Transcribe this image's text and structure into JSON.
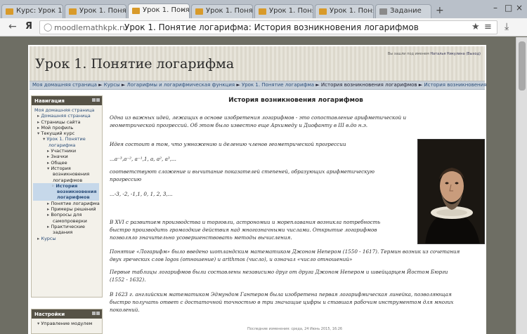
{
  "browser": {
    "tabs": [
      {
        "label": "Курс: Урок 1. Г",
        "active": false
      },
      {
        "label": "Урок 1. Понятие",
        "active": false
      },
      {
        "label": "Урок 1. Понятие",
        "active": true
      },
      {
        "label": "Урок 1. Понятие",
        "active": false
      },
      {
        "label": "Урок 1. Понятие",
        "active": false
      },
      {
        "label": "Урок 1. Понятие",
        "active": false
      },
      {
        "label": "Задание",
        "active": false
      }
    ],
    "new_tab": "+",
    "yandex": "Я",
    "url_domain": "moodlemathkpk.ru",
    "url_title": "Урок 1. Понятие логарифма: История возникновения логарифмов"
  },
  "page": {
    "header_title": "Урок 1. Понятие логарифма",
    "login_text": "Вы зашли под именем",
    "login_user": "Наталья Никулина",
    "login_exit": "(Выход)",
    "breadcrumb": {
      "home": "Моя домашняя страница",
      "courses": "Курсы",
      "category": "Логарифмы и логарифмическая функция",
      "lesson": "Урок 1. Понятие логарифма",
      "page1": "История возникновения логарифмов",
      "page2": "История возникновения логарифмов"
    }
  },
  "navigation": {
    "title": "Навигация",
    "home": "Моя домашняя страница",
    "items": [
      {
        "label": "Домашняя страница",
        "style": "link"
      },
      {
        "label": "Страницы сайта",
        "style": "plain"
      },
      {
        "label": "Мой профиль",
        "style": "plain"
      },
      {
        "label": "Текущий курс",
        "style": "plain"
      },
      {
        "label": "Урок 1. Понятие",
        "style": "link"
      },
      {
        "label": "логарифма",
        "style": "link"
      },
      {
        "label": "Участники",
        "style": "plain"
      },
      {
        "label": "Значки",
        "style": "plain"
      },
      {
        "label": "Общее",
        "style": "plain"
      },
      {
        "label": "История",
        "style": "plain"
      },
      {
        "label": "возникновения",
        "style": "plain"
      },
      {
        "label": "логарифмов",
        "style": "plain"
      },
      {
        "label": "История",
        "style": "current"
      },
      {
        "label": "возникновения",
        "style": "current"
      },
      {
        "label": "логарифмов",
        "style": "current"
      },
      {
        "label": "Понятие логарифма",
        "style": "plain"
      },
      {
        "label": "Примеры решений",
        "style": "plain"
      },
      {
        "label": "Вопросы для",
        "style": "plain"
      },
      {
        "label": "самопроверки",
        "style": "plain"
      },
      {
        "label": "Практические",
        "style": "plain"
      },
      {
        "label": "задания",
        "style": "plain"
      },
      {
        "label": "Курсы",
        "style": "link"
      }
    ]
  },
  "settings": {
    "title": "Настройки",
    "item": "Управление модулем"
  },
  "content": {
    "heading": "История возникновения логарифмов",
    "p1a": "Одна из важных идей, лежащих в основе  изобретения логарифмов - это сопоставление  арифметической и",
    "p1b": "геометрической прогрессий. Об этом было известно еще  Архимеду  и Диофанту  в III в.до н.э.",
    "p2": "Идея состоит в том, что умножению и делению членов геометрической прогрессии",
    "p3": "...a⁻³,a⁻², a⁻¹,1, a, a², a³,...",
    "p4a": "соответствуют сложение и вычитание показателей степеней, образующих арифметическую",
    "p4b": "прогрессию",
    "p5": "...-3, -2, -1,1, 0, 1, 2, 3,...",
    "p6a": "В XVI с развитием   производства и торговли, астрономии и мореплавания возникла  потребность",
    "p6b": "быстро производить громоздкие действия над многозначными числами. Открытие логарифмов",
    "p6c": "позволяло значительно усовершенствовать методы вычисления.",
    "p7a": "Понятие  «Логарифм» было введено шотландским математиком Джоном Непером (1550 - 1617). Термин возник из сочетания",
    "p7b": "двух греческих слов logos (отношение) и arithmos (число), и означал «число отношений»",
    "p8a": "Первые таблицы логарифмов были составлены независимо друг от друга Джоном Непером и швейцарцем Йостом Бюрги",
    "p8b": "(1552 - 1632).",
    "p9a": "В 1623 г. английским математиком Эдмундом Гантером была изобретена первая логарифмическая линейка, позволяющая",
    "p9b": "быстро получать ответ с достаточной точностью в три значащие цифры и ставшая рабочим инструментом для многих",
    "p9c": "поколений.",
    "footer": "Последние изменения: среда, 24 Июнь 2015, 16:26"
  },
  "colors": {
    "block_header": "#565246",
    "link": "#2d4f7a",
    "navbar": "#c8d1da"
  }
}
